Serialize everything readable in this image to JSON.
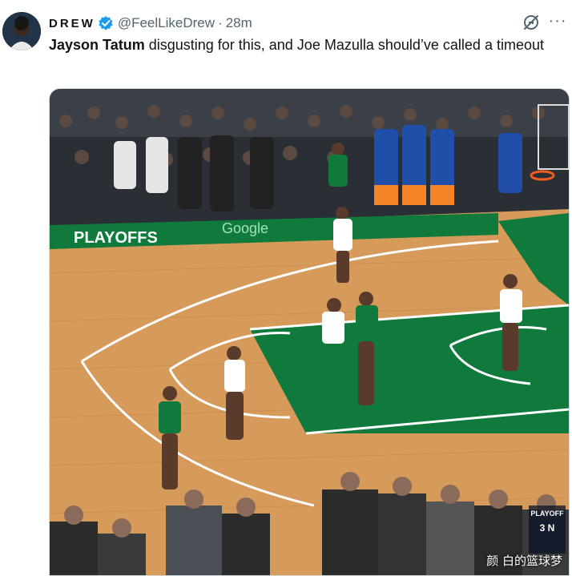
{
  "tweet": {
    "display_name": "DREW",
    "handle": "@FeelLikeDrew",
    "separator": "·",
    "time": "28m",
    "text_bold": "Jayson Tatum",
    "text_rest": " disgusting for this, and Joe Mazulla should’ve called a timeout",
    "more_label": "···"
  },
  "media": {
    "court_banner": "PLAYOFFS",
    "sponsor": "Google",
    "badge_text": "PLAYOFF",
    "badge_sub": "3 N",
    "watermark": "颜 白的篮球梦"
  },
  "icons": {
    "verified": "verified-badge-icon",
    "grok": "grok-icon",
    "more": "more-options-icon"
  },
  "colors": {
    "verified_blue": "#1d9bf0",
    "secondary_text": "#536471",
    "court_green": "#0f7a3c",
    "hardwood": "#d69a5a"
  }
}
